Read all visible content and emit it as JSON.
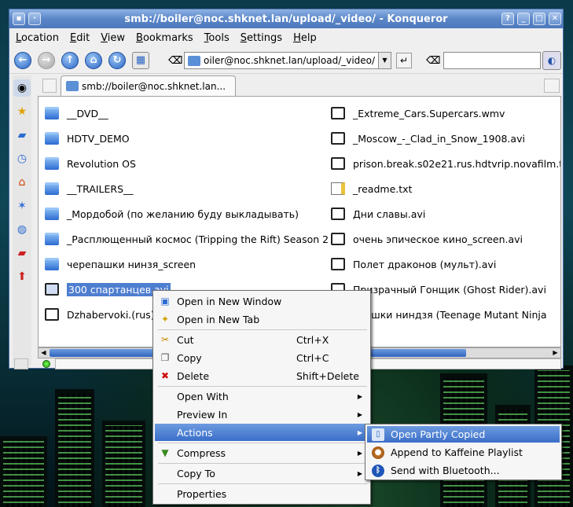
{
  "window": {
    "title": "smb://boiler@noc.shknet.lan/upload/_video/ - Konqueror"
  },
  "menubar": [
    "Location",
    "Edit",
    "View",
    "Bookmarks",
    "Tools",
    "Settings",
    "Help"
  ],
  "toolbar": {
    "url": "oiler@noc.shknet.lan/upload/_video/",
    "search_value": ""
  },
  "tab": {
    "label": "smb://boiler@noc.shknet.lan..."
  },
  "files_left": [
    {
      "name": "__DVD__",
      "type": "folder"
    },
    {
      "name": "HDTV_DEMO",
      "type": "folder"
    },
    {
      "name": "Revolution OS",
      "type": "folder"
    },
    {
      "name": "__TRAILERS__",
      "type": "folder"
    },
    {
      "name": "_Мордобой (по желанию буду выкладывать)",
      "type": "folder"
    },
    {
      "name": "_Расплющенный космос (Tripping the Rift) Season 2",
      "type": "folder"
    },
    {
      "name": "черепашки нинзя_screen",
      "type": "folder"
    },
    {
      "name": "300 спартанцев.avi",
      "type": "video"
    },
    {
      "name": "Dzhabervoki.(rus).",
      "type": "video"
    }
  ],
  "files_right": [
    {
      "name": "_Extreme_Cars.Supercars.wmv",
      "type": "video"
    },
    {
      "name": "_Moscow_-_Clad_in_Snow_1908.avi",
      "type": "video"
    },
    {
      "name": "prison.break.s02e21.rus.hdtvrip.novafilm.tv",
      "type": "video"
    },
    {
      "name": "_readme.txt",
      "type": "text"
    },
    {
      "name": "Дни славы.avi",
      "type": "video"
    },
    {
      "name": "очень эпическое кино_screen.avi",
      "type": "video"
    },
    {
      "name": "Полет драконов (мульт).avi",
      "type": "video"
    },
    {
      "name": "Призрачный Гонщик (Ghost Rider).avi",
      "type": "video"
    },
    {
      "name": "epашки ниндзя (Teenage Mutant Ninja",
      "type": "video"
    }
  ],
  "context_menu": {
    "items": [
      {
        "label": "Open in New Window",
        "shortcut": "",
        "icon": "new-window-icon"
      },
      {
        "label": "Open in New Tab",
        "shortcut": "",
        "icon": "new-tab-icon"
      },
      {
        "label": "Cut",
        "shortcut": "Ctrl+X",
        "icon": "scissors-icon"
      },
      {
        "label": "Copy",
        "shortcut": "Ctrl+C",
        "icon": "copy-icon"
      },
      {
        "label": "Delete",
        "shortcut": "Shift+Delete",
        "icon": "delete-icon"
      },
      {
        "label": "Open With",
        "shortcut": "",
        "icon": ""
      },
      {
        "label": "Preview In",
        "shortcut": "",
        "icon": ""
      },
      {
        "label": "Actions",
        "shortcut": "",
        "icon": ""
      },
      {
        "label": "Compress",
        "shortcut": "",
        "icon": "compress-icon"
      },
      {
        "label": "Copy To",
        "shortcut": "",
        "icon": ""
      },
      {
        "label": "Properties",
        "shortcut": "",
        "icon": ""
      }
    ]
  },
  "actions_submenu": [
    {
      "label": "Open Partly Copied"
    },
    {
      "label": "Append to Kaffeine Playlist"
    },
    {
      "label": "Send with Bluetooth..."
    }
  ],
  "colors": {
    "titlebar": "#5a86c8",
    "selection": "#4e7ed0"
  }
}
